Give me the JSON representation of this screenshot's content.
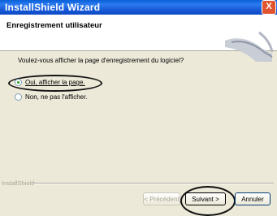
{
  "window": {
    "title": "InstallShield Wizard",
    "close_label": "X"
  },
  "header": {
    "title": "Enregistrement utilisateur"
  },
  "content": {
    "question": "Voulez-vous afficher la page d'enregistrement du logiciel?",
    "options": [
      {
        "label": "Oui, afficher la page.",
        "selected": true
      },
      {
        "label": "Non, ne pas l'afficher.",
        "selected": false
      }
    ]
  },
  "footer": {
    "brand": "InstallShield",
    "back_label": "< Précédent",
    "next_label": "Suivant >",
    "cancel_label": "Annuler"
  },
  "colors": {
    "title_bar": "#0a5fd8",
    "face": "#ece9d8",
    "annotation": "#111111"
  }
}
